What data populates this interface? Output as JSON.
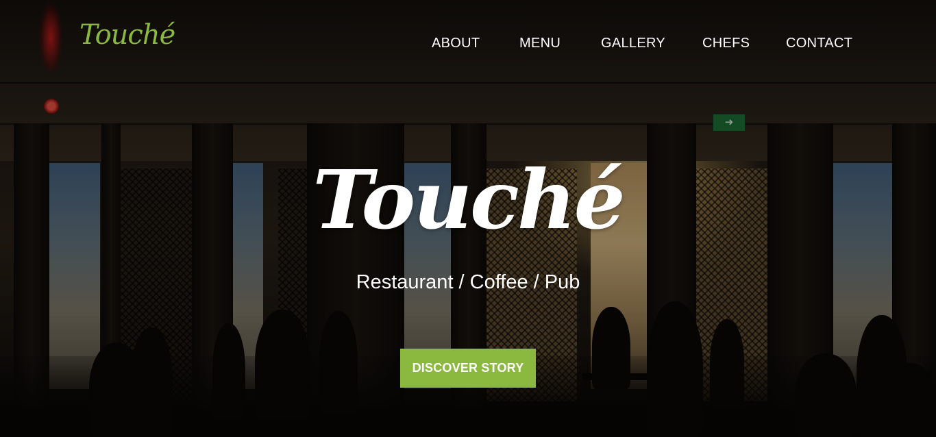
{
  "brand": {
    "logo_text": "Touché",
    "accent_color": "#8bb83f"
  },
  "nav": {
    "items": [
      {
        "label": "ABOUT"
      },
      {
        "label": "MENU"
      },
      {
        "label": "GALLERY"
      },
      {
        "label": "CHEFS"
      },
      {
        "label": "CONTACT"
      }
    ]
  },
  "hero": {
    "title": "Touché",
    "subtitle": "Restaurant / Coffee / Pub",
    "cta_label": "DISCOVER STORY",
    "background": "restaurant-interior-photo"
  }
}
